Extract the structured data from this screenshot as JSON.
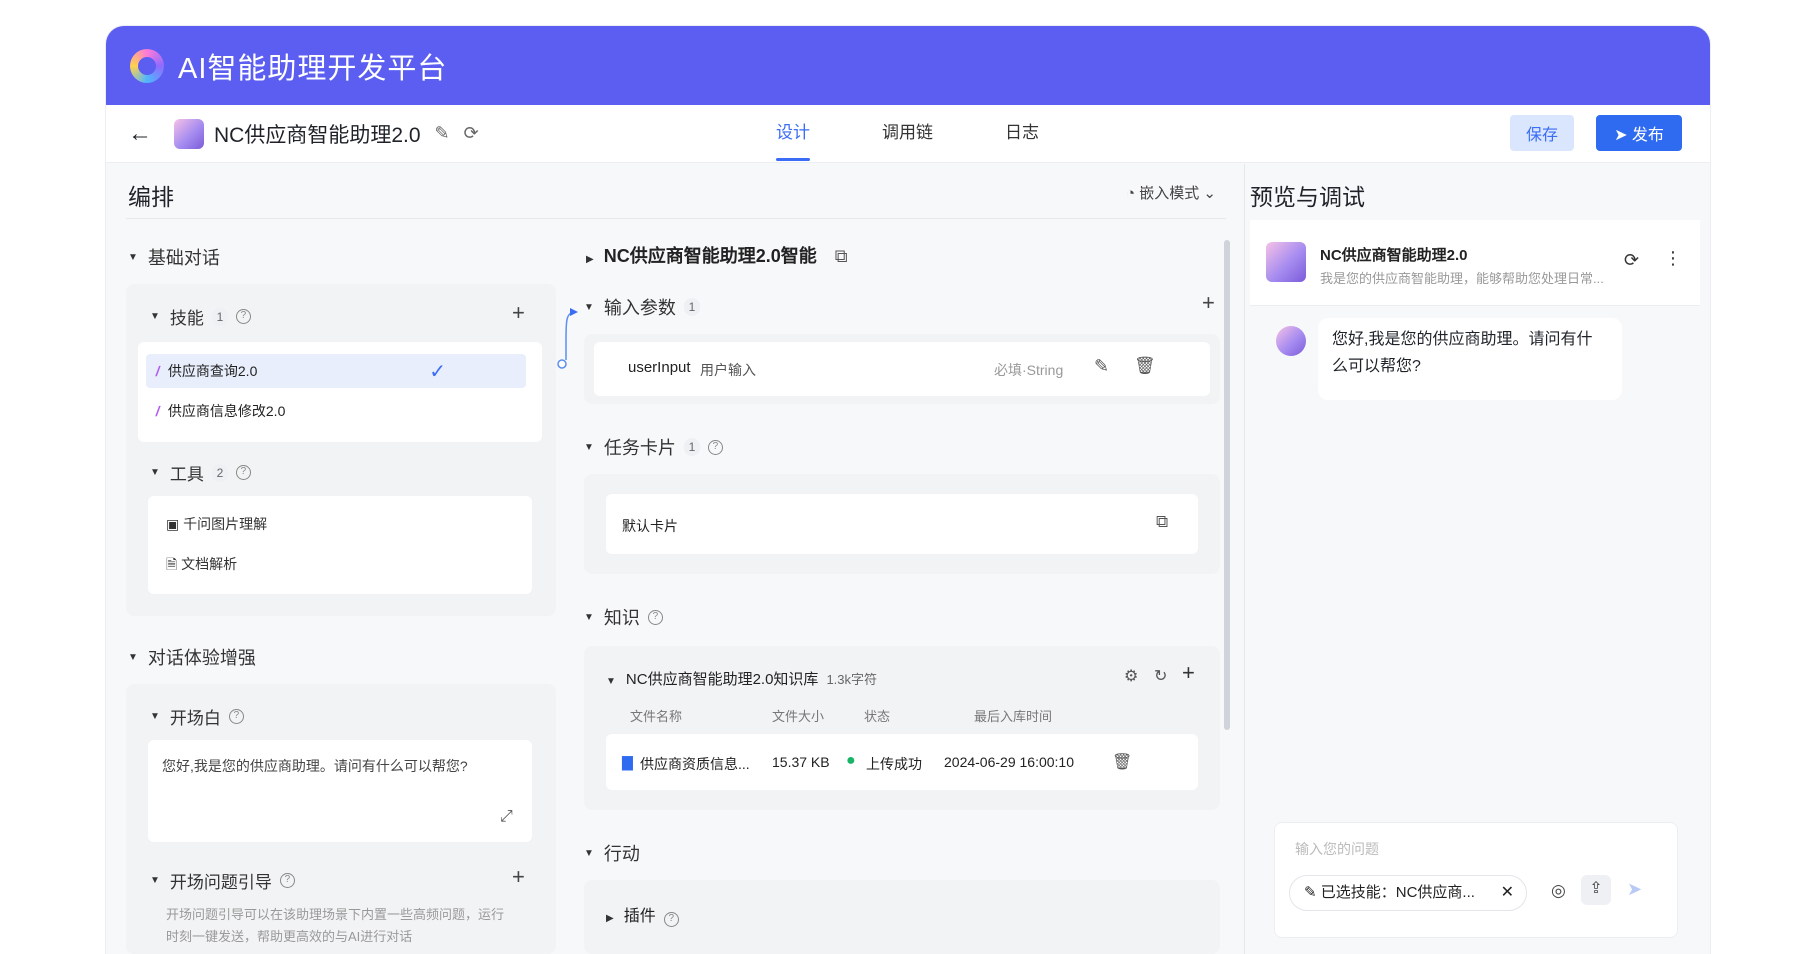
{
  "brand": "AI智能助理开发平台",
  "header": {
    "app_title": "NC供应商智能助理2.0",
    "tabs": [
      "设计",
      "调用链",
      "日志"
    ],
    "save_label": "保存",
    "publish_label": "发布"
  },
  "arrange": {
    "title": "编排",
    "mode": "嵌入模式"
  },
  "left": {
    "basic_dialog": "基础对话",
    "skills": {
      "label": "技能",
      "count": "1",
      "items": [
        "供应商查询2.0",
        "供应商信息修改2.0"
      ]
    },
    "tools": {
      "label": "工具",
      "count": "2",
      "items": [
        "千问图片理解",
        "文档解析"
      ]
    },
    "enhance": "对话体验增强",
    "opening": {
      "label": "开场白",
      "text": "您好,我是您的供应商助理。请问有什么可以帮您?"
    },
    "opening_guide": {
      "label": "开场问题引导",
      "desc_line1": "开场问题引导可以在该助理场景下内置一些高频问题，运行",
      "desc_line2": "时刻一键发送，帮助更高效的与AI进行对话"
    }
  },
  "middle": {
    "flow_title": "NC供应商智能助理2.0智能",
    "input_params": {
      "label": "输入参数",
      "count": "1",
      "name": "userInput",
      "desc": "用户输入",
      "type": "必填·String"
    },
    "task_card": {
      "label": "任务卡片",
      "count": "1",
      "default": "默认卡片"
    },
    "knowledge": {
      "label": "知识",
      "kb_name": "NC供应商智能助理2.0知识库",
      "kb_size": "1.3k字符",
      "columns": [
        "文件名称",
        "文件大小",
        "状态",
        "最后入库时间"
      ],
      "file": {
        "name": "供应商资质信息...",
        "size": "15.37 KB",
        "status": "上传成功",
        "time": "2024-06-29 16:00:10"
      }
    },
    "action": {
      "label": "行动",
      "plugin": "插件"
    }
  },
  "right": {
    "title": "预览与调试",
    "bot_name": "NC供应商智能助理2.0",
    "bot_desc": "我是您的供应商智能助理，能够帮助您处理日常...",
    "greeting": "您好,我是您的供应商助理。请问有什么可以帮您?",
    "input_placeholder": "输入您的问题",
    "selected_skill": "已选技能：NC供应商..."
  },
  "colors": {
    "brand_bar": "#5b5ef0",
    "primary": "#3b6cf6",
    "success": "#18b566"
  }
}
